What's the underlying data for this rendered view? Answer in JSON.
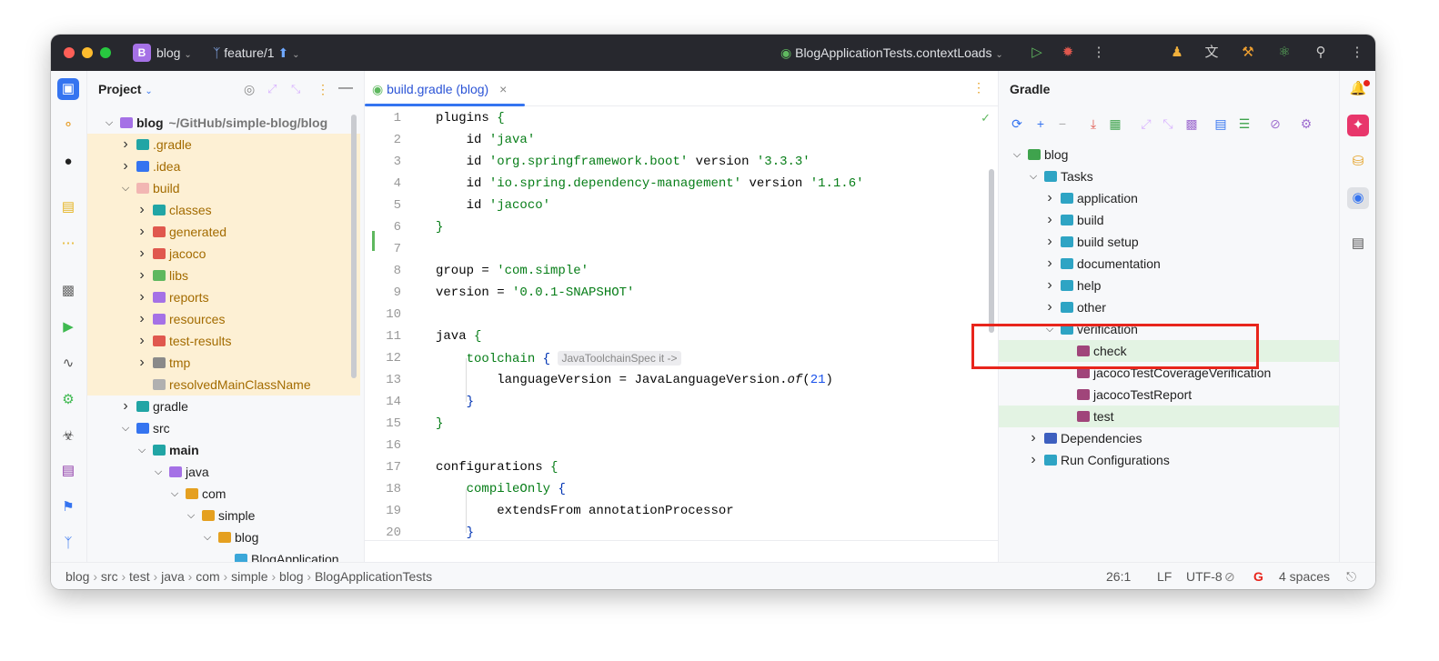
{
  "titlebar": {
    "project_badge": "B",
    "project": "blog",
    "branch": "feature/1",
    "run_config": "BlogApplicationTests.contextLoads"
  },
  "project_panel": {
    "title": "Project",
    "rows": [
      {
        "label": "blog",
        "path": "~/GitHub/simple-blog/blog",
        "depth": 0,
        "expanded": true,
        "highlight": false,
        "icon": "folder-module"
      },
      {
        "label": ".gradle",
        "depth": 1,
        "expanded": false,
        "highlight": true,
        "icon": "folder-teal"
      },
      {
        "label": ".idea",
        "depth": 1,
        "expanded": false,
        "highlight": true,
        "icon": "folder-blue"
      },
      {
        "label": "build",
        "depth": 1,
        "expanded": true,
        "highlight": true,
        "icon": "folder-excluded"
      },
      {
        "label": "classes",
        "depth": 2,
        "expanded": false,
        "highlight": true,
        "icon": "folder-teal"
      },
      {
        "label": "generated",
        "depth": 2,
        "expanded": false,
        "highlight": true,
        "icon": "folder-red"
      },
      {
        "label": "jacoco",
        "depth": 2,
        "expanded": false,
        "highlight": true,
        "icon": "folder-red"
      },
      {
        "label": "libs",
        "depth": 2,
        "expanded": false,
        "highlight": true,
        "icon": "folder-green"
      },
      {
        "label": "reports",
        "depth": 2,
        "expanded": false,
        "highlight": true,
        "icon": "folder-purple"
      },
      {
        "label": "resources",
        "depth": 2,
        "expanded": false,
        "highlight": true,
        "icon": "folder-purple"
      },
      {
        "label": "test-results",
        "depth": 2,
        "expanded": false,
        "highlight": true,
        "icon": "folder-red"
      },
      {
        "label": "tmp",
        "depth": 2,
        "expanded": false,
        "highlight": true,
        "icon": "folder-gray"
      },
      {
        "label": "resolvedMainClassName",
        "depth": 2,
        "leaf": true,
        "highlight": true,
        "icon": "file"
      },
      {
        "label": "gradle",
        "depth": 1,
        "expanded": false,
        "highlight": false,
        "icon": "folder-teal"
      },
      {
        "label": "src",
        "depth": 1,
        "expanded": true,
        "highlight": false,
        "icon": "folder-blue"
      },
      {
        "label": "main",
        "depth": 2,
        "expanded": true,
        "highlight": false,
        "icon": "folder-teal",
        "bold": true
      },
      {
        "label": "java",
        "depth": 3,
        "expanded": true,
        "highlight": false,
        "icon": "folder-purple"
      },
      {
        "label": "com",
        "depth": 4,
        "expanded": true,
        "highlight": false,
        "icon": "folder-yellow"
      },
      {
        "label": "simple",
        "depth": 5,
        "expanded": true,
        "highlight": false,
        "icon": "folder-yellow"
      },
      {
        "label": "blog",
        "depth": 6,
        "expanded": true,
        "highlight": false,
        "icon": "folder-yellow"
      },
      {
        "label": "BlogApplication",
        "depth": 7,
        "leaf": true,
        "highlight": false,
        "icon": "spring-class"
      }
    ]
  },
  "editor": {
    "tab_label": "build.gradle (blog)",
    "lines": [
      {
        "n": "1"
      },
      {
        "n": "2"
      },
      {
        "n": "3"
      },
      {
        "n": "4"
      },
      {
        "n": "5"
      },
      {
        "n": "6"
      },
      {
        "n": "7"
      },
      {
        "n": "8"
      },
      {
        "n": "9"
      },
      {
        "n": "10"
      },
      {
        "n": "11"
      },
      {
        "n": "12"
      },
      {
        "n": "13"
      },
      {
        "n": "14"
      },
      {
        "n": "15"
      },
      {
        "n": "16"
      },
      {
        "n": "17"
      },
      {
        "n": "18"
      },
      {
        "n": "19"
      },
      {
        "n": "20"
      }
    ],
    "code": {
      "l1_kw": "plugins",
      "l2_a": "id ",
      "l2_s": "'java'",
      "l3_a": "id ",
      "l3_s": "'org.springframework.boot'",
      "l3_b": " version ",
      "l3_v": "'3.3.3'",
      "l4_a": "id ",
      "l4_s": "'io.spring.dependency-management'",
      "l4_b": " version ",
      "l4_v": "'1.1.6'",
      "l5_a": "id ",
      "l5_s": "'jacoco'",
      "l8_a": "group = ",
      "l8_s": "'com.simple'",
      "l9_a": "version = ",
      "l9_s": "'0.0.1-SNAPSHOT'",
      "l11_kw": "java",
      "l12_kw": "toolchain",
      "l12_hint": "JavaToolchainSpec it ->",
      "l13_a": "languageVersion = JavaLanguageVersion.",
      "l13_fn": "of",
      "l13_num": "21",
      "l17_kw": "configurations",
      "l18_kw": "compileOnly",
      "l19_a": "extendsFrom annotationProcessor"
    }
  },
  "gradle_panel": {
    "title": "Gradle",
    "rows": [
      {
        "label": "blog",
        "depth": 0,
        "expanded": true,
        "icon": "elephant"
      },
      {
        "label": "Tasks",
        "depth": 1,
        "expanded": true,
        "icon": "folder-task"
      },
      {
        "label": "application",
        "depth": 2,
        "expanded": false,
        "icon": "folder-task"
      },
      {
        "label": "build",
        "depth": 2,
        "expanded": false,
        "icon": "folder-task"
      },
      {
        "label": "build setup",
        "depth": 2,
        "expanded": false,
        "icon": "folder-task"
      },
      {
        "label": "documentation",
        "depth": 2,
        "expanded": false,
        "icon": "folder-task"
      },
      {
        "label": "help",
        "depth": 2,
        "expanded": false,
        "icon": "folder-task"
      },
      {
        "label": "other",
        "depth": 2,
        "expanded": false,
        "icon": "folder-task"
      },
      {
        "label": "verification",
        "depth": 2,
        "expanded": true,
        "icon": "folder-task"
      },
      {
        "label": "check",
        "depth": 3,
        "leaf": true,
        "icon": "task",
        "selected": true
      },
      {
        "label": "jacocoTestCoverageVerification",
        "depth": 3,
        "leaf": true,
        "icon": "task"
      },
      {
        "label": "jacocoTestReport",
        "depth": 3,
        "leaf": true,
        "icon": "task"
      },
      {
        "label": "test",
        "depth": 3,
        "leaf": true,
        "icon": "task",
        "selected": true
      },
      {
        "label": "Dependencies",
        "depth": 1,
        "expanded": false,
        "icon": "library"
      },
      {
        "label": "Run Configurations",
        "depth": 1,
        "expanded": false,
        "icon": "folder-task"
      }
    ]
  },
  "statusbar": {
    "breadcrumbs": [
      "blog",
      "src",
      "test",
      "java",
      "com",
      "simple",
      "blog",
      "BlogApplicationTests"
    ],
    "position": "26:1",
    "line_sep": "LF",
    "encoding": "UTF-8",
    "indent": "4 spaces"
  },
  "colors": {
    "accent": "#3574f0",
    "highlight_row": "#fdf0d4",
    "selected_row": "#e3f3e3",
    "annotation_box": "#e8251c"
  }
}
